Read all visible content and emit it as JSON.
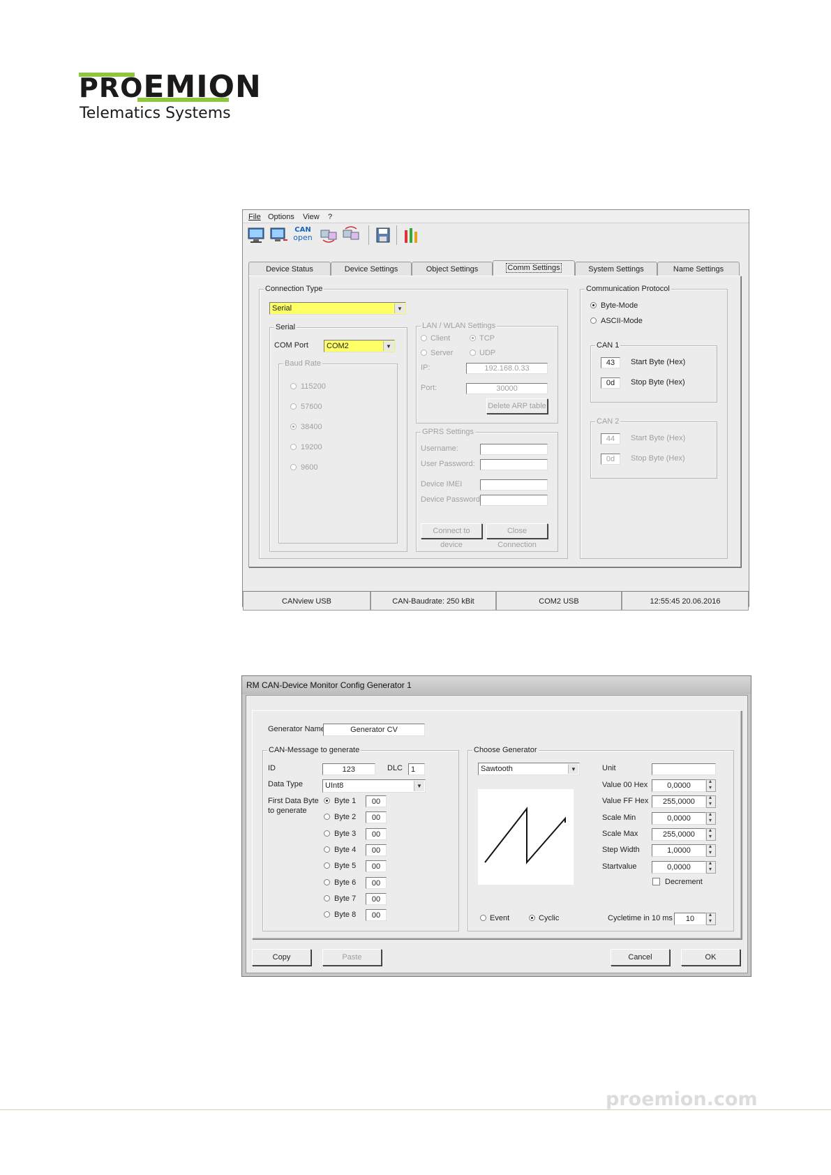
{
  "logo": {
    "pro": "PRO",
    "emion": "EMION",
    "tagline": "Telematics Systems",
    "bar_color": "#8dc63f"
  },
  "window1": {
    "menu": [
      "File",
      "Options",
      "View",
      "?"
    ],
    "toolbar_icons": [
      "monitor-icon",
      "monitor-network-icon",
      "canopen-icon",
      "transfer-icon",
      "transfer2-icon",
      "save-icon",
      "tools-icon"
    ],
    "canopen_label_top": "CAN",
    "canopen_label_bottom": "open",
    "tabs": [
      "Device Status",
      "Device Settings",
      "Object Settings",
      "Comm Settings",
      "System Settings",
      "Name Settings"
    ],
    "active_tab": "Comm Settings",
    "connection_type": {
      "title": "Connection Type",
      "value": "Serial"
    },
    "serial": {
      "title": "Serial",
      "com_port_label": "COM Port",
      "com_port_value": "COM2",
      "baud_title": "Baud Rate",
      "baud_rates": [
        "115200",
        "57600",
        "38400",
        "19200",
        "9600"
      ],
      "baud_selected": "38400"
    },
    "lan": {
      "title": "LAN / WLAN Settings",
      "client": "Client",
      "server": "Server",
      "tcp": "TCP",
      "udp": "UDP",
      "ip_label": "IP:",
      "ip_value": "192.168.0.33",
      "port_label": "Port:",
      "port_value": "30000",
      "delete_arp": "Delete ARP table"
    },
    "gprs": {
      "title": "GPRS Settings",
      "username": "Username:",
      "user_password": "User Password:",
      "device_imei": "Device IMEI",
      "device_password": "Device Password",
      "connect": "Connect to device",
      "close": "Close Connection"
    },
    "protocol": {
      "title": "Communication Protocol",
      "byte_mode": "Byte-Mode",
      "ascii_mode": "ASCII-Mode",
      "can1_title": "CAN 1",
      "can1_start": "43",
      "can1_stop": "0d",
      "can2_title": "CAN 2",
      "can2_start": "44",
      "can2_stop": "0d",
      "start_label": "Start Byte (Hex)",
      "stop_label": "Stop Byte (Hex)"
    },
    "status": [
      "CANview USB",
      "CAN-Baudrate: 250 kBit",
      "COM2  USB",
      "12:55:45  20.06.2016"
    ]
  },
  "window2": {
    "title": "RM CAN-Device Monitor Config Generator 1",
    "generator_name_label": "Generator Name",
    "generator_name_value": "Generator CV",
    "can_msg": {
      "title": "CAN-Message to generate",
      "id_label": "ID",
      "id_value": "123",
      "dlc_label": "DLC",
      "dlc_value": "1",
      "data_type_label": "Data Type",
      "data_type_value": "UInt8",
      "first_byte_label_1": "First Data Byte",
      "first_byte_label_2": "to generate",
      "bytes": [
        {
          "label": "Byte 1",
          "value": "00"
        },
        {
          "label": "Byte 2",
          "value": "00"
        },
        {
          "label": "Byte 3",
          "value": "00"
        },
        {
          "label": "Byte 4",
          "value": "00"
        },
        {
          "label": "Byte 5",
          "value": "00"
        },
        {
          "label": "Byte 6",
          "value": "00"
        },
        {
          "label": "Byte 7",
          "value": "00"
        },
        {
          "label": "Byte 8",
          "value": "00"
        }
      ],
      "selected_byte": "Byte 1"
    },
    "gen": {
      "title": "Choose Generator",
      "type": "Sawtooth",
      "unit_label": "Unit",
      "unit_value": "",
      "fields": [
        {
          "label": "Value 00 Hex",
          "value": "0,0000"
        },
        {
          "label": "Value FF Hex",
          "value": "255,0000"
        },
        {
          "label": "Scale Min",
          "value": "0,0000"
        },
        {
          "label": "Scale Max",
          "value": "255,0000"
        },
        {
          "label": "Step Width",
          "value": "1,0000"
        },
        {
          "label": "Startvalue",
          "value": "0,0000"
        }
      ],
      "decrement": "Decrement",
      "event": "Event",
      "cyclic": "Cyclic",
      "cycletime_label": "Cycletime in 10 ms",
      "cycletime_value": "10"
    },
    "buttons": {
      "copy": "Copy",
      "paste": "Paste",
      "cancel": "Cancel",
      "ok": "OK"
    }
  },
  "footer": {
    "site": "proemion.com",
    "line_color": "#c6dc9a"
  }
}
